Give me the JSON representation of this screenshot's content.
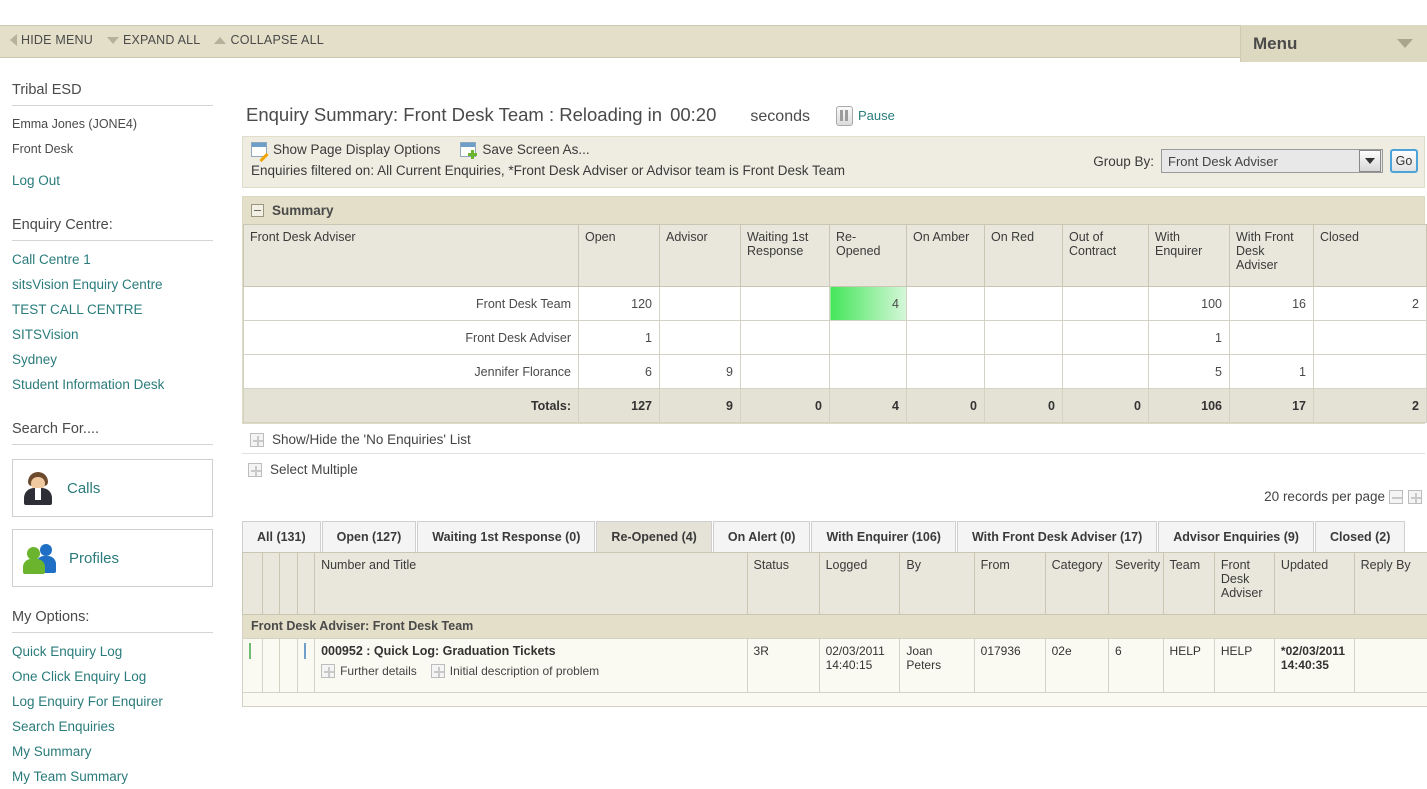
{
  "topbar": {
    "hide_menu": "HIDE MENU",
    "expand_all": "EXPAND ALL",
    "collapse_all": "COLLAPSE ALL",
    "menu_label": "Menu"
  },
  "sidebar": {
    "app_title": "Tribal ESD",
    "user_name": "Emma Jones (JONE4)",
    "user_team": "Front Desk",
    "log_out": "Log Out",
    "enquiry_centre_heading": "Enquiry Centre:",
    "enquiry_centres": [
      "Call Centre 1",
      "sitsVision Enquiry Centre",
      "TEST CALL CENTRE",
      "SITSVision",
      "Sydney",
      "Student Information Desk"
    ],
    "search_for_heading": "Search For....",
    "buttons": [
      {
        "label": "Calls",
        "icon": "person-avatar-icon"
      },
      {
        "label": "Profiles",
        "icon": "two-people-icon"
      }
    ],
    "my_options_heading": "My Options:",
    "my_options": [
      "Quick Enquiry Log",
      "One Click Enquiry Log",
      "Log Enquiry For Enquirer",
      "Search Enquiries",
      "My Summary",
      "My Team Summary"
    ]
  },
  "main": {
    "heading_prefix": "Enquiry Summary: Front Desk Team : Reloading in",
    "countdown": "00:20",
    "seconds_label": "seconds",
    "pause_label": "Pause",
    "show_page_display_options": "Show Page Display Options",
    "save_screen_as": "Save Screen As...",
    "filter_text": "Enquiries filtered on: All Current Enquiries, *Front Desk Adviser or Advisor team is Front Desk Team",
    "group_by_label": "Group By:",
    "group_by_value": "Front Desk Adviser",
    "go_label": "Go",
    "summary_title": "Summary",
    "show_hide_no_enquiries": "Show/Hide the 'No Enquiries' List",
    "select_multiple": "Select Multiple",
    "records_per_page": "20 records per page"
  },
  "summary_table": {
    "columns": [
      "Front Desk Adviser",
      "Open",
      "Advisor",
      "Waiting 1st Response",
      "Re-Opened",
      "On Amber",
      "On Red",
      "Out of Contract",
      "With Enquirer",
      "With Front Desk Adviser",
      "Closed"
    ],
    "rows": [
      {
        "name": "Front Desk Team",
        "values": [
          "120",
          "",
          "",
          "4",
          "",
          "",
          "",
          "100",
          "16",
          "2"
        ],
        "highlight_index": 3
      },
      {
        "name": "Front Desk Adviser",
        "values": [
          "1",
          "",
          "",
          "",
          "",
          "",
          "",
          "1",
          "",
          ""
        ],
        "highlight_index": -1
      },
      {
        "name": "Jennifer Florance",
        "values": [
          "6",
          "9",
          "",
          "",
          "",
          "",
          "",
          "5",
          "1",
          ""
        ],
        "highlight_index": -1
      }
    ],
    "totals_label": "Totals:",
    "totals": [
      "127",
      "9",
      "0",
      "4",
      "0",
      "0",
      "0",
      "106",
      "17",
      "2"
    ]
  },
  "tabs": [
    {
      "label": "All (131)",
      "active": false
    },
    {
      "label": "Open (127)",
      "active": false
    },
    {
      "label": "Waiting 1st Response (0)",
      "active": false
    },
    {
      "label": "Re-Opened (4)",
      "active": true
    },
    {
      "label": "On Alert (0)",
      "active": false
    },
    {
      "label": "With Enquirer (106)",
      "active": false
    },
    {
      "label": "With Front Desk Adviser (17)",
      "active": false
    },
    {
      "label": "Advisor Enquiries (9)",
      "active": false
    },
    {
      "label": "Closed (2)",
      "active": false
    }
  ],
  "enquiry_table": {
    "columns": [
      "Number and Title",
      "Status",
      "Logged",
      "By",
      "From",
      "Category",
      "Severity",
      "Team",
      "Front Desk Adviser",
      "Updated",
      "Reply By"
    ],
    "group_label": "Front Desk Adviser: Front Desk Team",
    "rows": [
      {
        "title": "000952 : Quick Log: Graduation Tickets",
        "further_details": "Further details",
        "initial_description": "Initial description of problem",
        "status": "3R",
        "logged": "02/03/2011 14:40:15",
        "by": "Joan Peters",
        "from": "017936",
        "category": "02e",
        "severity": "6",
        "team": "HELP",
        "adviser": "HELP",
        "updated": "*02/03/2011 14:40:35",
        "reply_by": ""
      }
    ]
  },
  "colors": {
    "topbar_bg": "#e3dfc8",
    "link": "#2a7b7b",
    "highlight_green": "#45e65a",
    "alert_red": "#dd0000"
  }
}
